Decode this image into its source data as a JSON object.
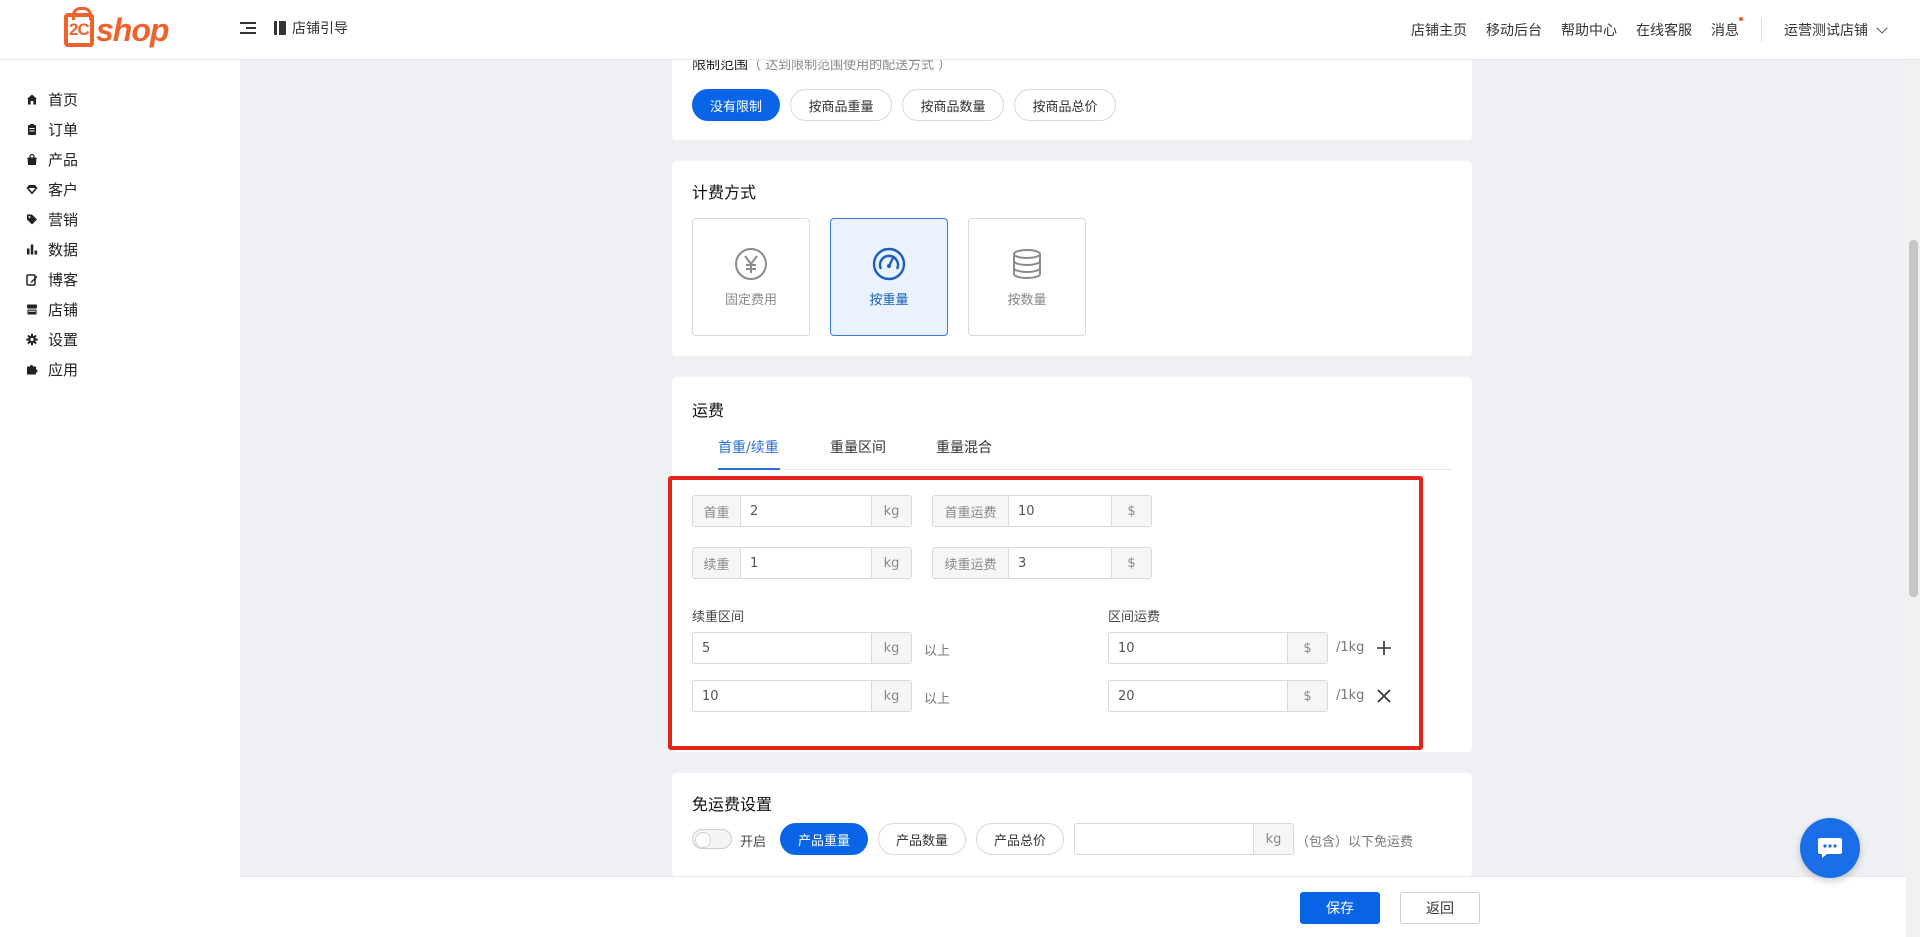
{
  "brand": {
    "logo_mark": "2C",
    "logo_text": "shop",
    "color": "#f0622b"
  },
  "header": {
    "guide_label": "店铺引导",
    "links": [
      "店铺主页",
      "移动后台",
      "帮助中心",
      "在线客服",
      "消息"
    ],
    "store_name": "运营测试店铺"
  },
  "sidebar": {
    "items": [
      {
        "label": "首页",
        "icon": "home-icon"
      },
      {
        "label": "订单",
        "icon": "clipboard-icon"
      },
      {
        "label": "产品",
        "icon": "bag-icon"
      },
      {
        "label": "客户",
        "icon": "diamond-icon"
      },
      {
        "label": "营销",
        "icon": "tag-icon"
      },
      {
        "label": "数据",
        "icon": "bar-chart-icon"
      },
      {
        "label": "博客",
        "icon": "edit-icon"
      },
      {
        "label": "店铺",
        "icon": "store-icon"
      },
      {
        "label": "设置",
        "icon": "gear-icon"
      },
      {
        "label": "应用",
        "icon": "puzzle-icon"
      }
    ]
  },
  "scope": {
    "title": "限制范围",
    "hint": "（ 达到限制范围使用的配送方式 ）",
    "options": [
      "没有限制",
      "按商品重量",
      "按商品数量",
      "按商品总价"
    ],
    "selected": "没有限制"
  },
  "billing": {
    "title": "计费方式",
    "modes": [
      {
        "label": "固定费用",
        "icon": "yen-circle-icon"
      },
      {
        "label": "按重量",
        "icon": "gauge-icon"
      },
      {
        "label": "按数量",
        "icon": "database-icon"
      }
    ],
    "selected": "按重量"
  },
  "freight": {
    "title": "运费",
    "tabs": [
      "首重/续重",
      "重量区间",
      "重量混合"
    ],
    "active_tab": "首重/续重",
    "first_weight": {
      "label": "首重",
      "value": "2",
      "unit": "kg"
    },
    "first_fee": {
      "label": "首重运费",
      "value": "10",
      "unit": "$"
    },
    "extra_weight": {
      "label": "续重",
      "value": "1",
      "unit": "kg"
    },
    "extra_fee": {
      "label": "续重运费",
      "value": "3",
      "unit": "$"
    },
    "range_label": "续重区间",
    "range_fee_label": "区间运费",
    "above_text": "以上",
    "per_unit": "/1kg",
    "ranges": [
      {
        "weight": "5",
        "weight_unit": "kg",
        "fee": "10",
        "fee_unit": "$"
      },
      {
        "weight": "10",
        "weight_unit": "kg",
        "fee": "20",
        "fee_unit": "$"
      }
    ]
  },
  "free_shipping": {
    "title": "免运费设置",
    "toggle_label": "开启",
    "options": [
      "产品重量",
      "产品数量",
      "产品总价"
    ],
    "selected": "产品重量",
    "input_value": "",
    "unit": "kg",
    "suffix": "（包含）以下免运费"
  },
  "footer": {
    "save_label": "保存",
    "back_label": "返回"
  },
  "colors": {
    "primary": "#0a64e6",
    "highlight": "#e3241b"
  }
}
